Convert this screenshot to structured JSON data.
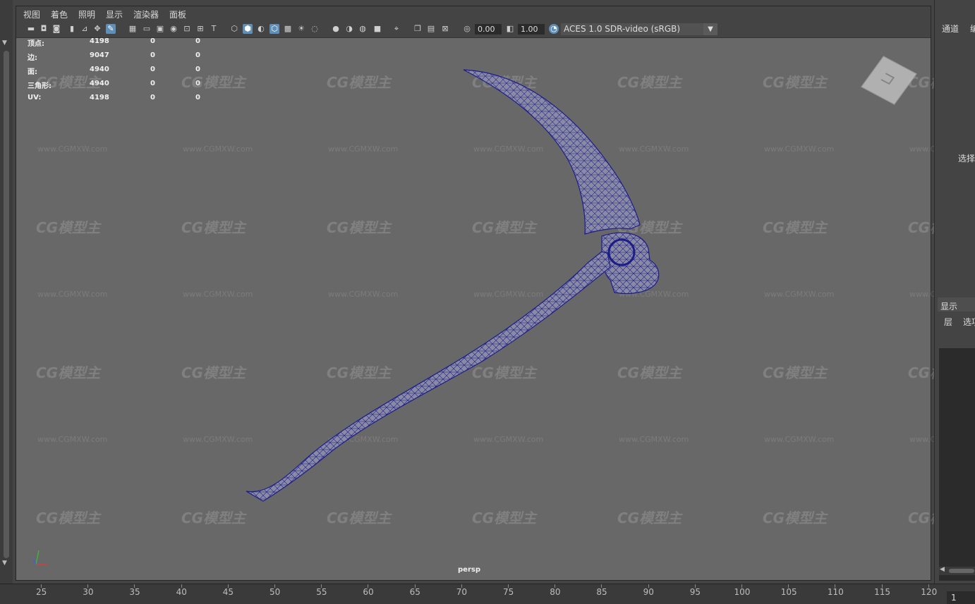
{
  "menu": [
    "视图",
    "着色",
    "照明",
    "显示",
    "渲染器",
    "面板"
  ],
  "toolbar": {
    "exposure_value": "0.00",
    "gamma_value": "1.00",
    "color_space": "ACES 1.0 SDR-video (sRGB)"
  },
  "hud": {
    "rows": [
      {
        "label": "顶点:",
        "v1": "4198",
        "v2": "0",
        "v3": "0"
      },
      {
        "label": "边:",
        "v1": "9047",
        "v2": "0",
        "v3": "0"
      },
      {
        "label": "面:",
        "v1": "4940",
        "v2": "0",
        "v3": "0"
      },
      {
        "label": "三角形:",
        "v1": "4940",
        "v2": "0",
        "v3": "0"
      },
      {
        "label": "UV:",
        "v1": "4198",
        "v2": "0",
        "v3": "0"
      }
    ]
  },
  "viewport": {
    "camera_label": "persp"
  },
  "watermark": {
    "logo_text": "CG模型主",
    "url_text": "www.CGMXW.com"
  },
  "right_panel": {
    "channel_tab": "通道",
    "edit_tab": "编",
    "select_label": "选择",
    "display_tab": "显示",
    "layers_label": "层",
    "options_label": "选项"
  },
  "timeline": {
    "ticks": [
      "25",
      "30",
      "35",
      "40",
      "45",
      "50",
      "55",
      "60",
      "65",
      "70",
      "75",
      "80",
      "85",
      "90",
      "95",
      "100",
      "105",
      "110",
      "115",
      "120"
    ],
    "current_frame": "1"
  },
  "colors": {
    "viewport_bg": "#686868",
    "wireframe": "#1d1d8a",
    "ui_bg": "#444444"
  }
}
